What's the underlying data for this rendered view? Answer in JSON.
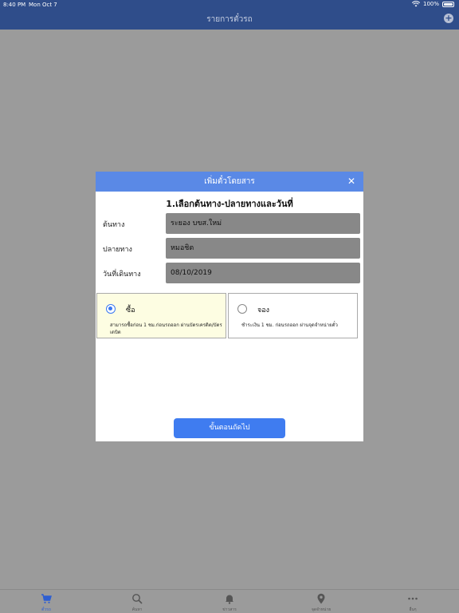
{
  "status_bar": {
    "time": "8:40 PM",
    "date": "Mon Oct 7",
    "battery": "100%"
  },
  "nav": {
    "title": "รายการตั๋วรถ",
    "add_symbol": "+"
  },
  "dialog": {
    "title": "เพิ่มตั๋วโดยสาร",
    "close_symbol": "✕",
    "step_title": "1.เลือกต้นทาง-ปลายทางและวันที่",
    "fields": {
      "origin": {
        "label": "ต้นทาง",
        "value": "ระยอง บขส.ใหม่"
      },
      "destination": {
        "label": "ปลายทาง",
        "value": "หมอชิต"
      },
      "travel_date": {
        "label": "วันที่เดินทาง",
        "value": "08/10/2019"
      }
    },
    "options": {
      "buy": {
        "title": "ซื้อ",
        "description": "สามารถซื้อก่อน 1 ชม.ก่อนรถออก ผ่านบัตรเครดิต/บัตรเดบิต",
        "selected": true
      },
      "book": {
        "title": "จอง",
        "description": "ชำระเงิน 1 ชม. ก่อนรถออก ผ่านจุดจำหน่ายตั๋ว",
        "selected": false
      }
    },
    "next_label": "ขั้นตอนถัดไป"
  },
  "tabs": [
    {
      "label": "ตั๋วรถ",
      "icon": "cart-icon",
      "active": true
    },
    {
      "label": "ค้นหา",
      "icon": "search-icon",
      "active": false
    },
    {
      "label": "ข่าวสาร",
      "icon": "bell-icon",
      "active": false
    },
    {
      "label": "จุดจำหน่าย",
      "icon": "location-pin-icon",
      "active": false
    },
    {
      "label": "อื่นๆ",
      "icon": "more-icon",
      "active": false
    }
  ],
  "colors": {
    "nav_bar": "#2f4d8a",
    "dialog_header": "#5a89e6",
    "primary_button": "#3f7cf0",
    "overlay": "#9b9b9b",
    "selected_option_bg": "#fdfde2"
  }
}
